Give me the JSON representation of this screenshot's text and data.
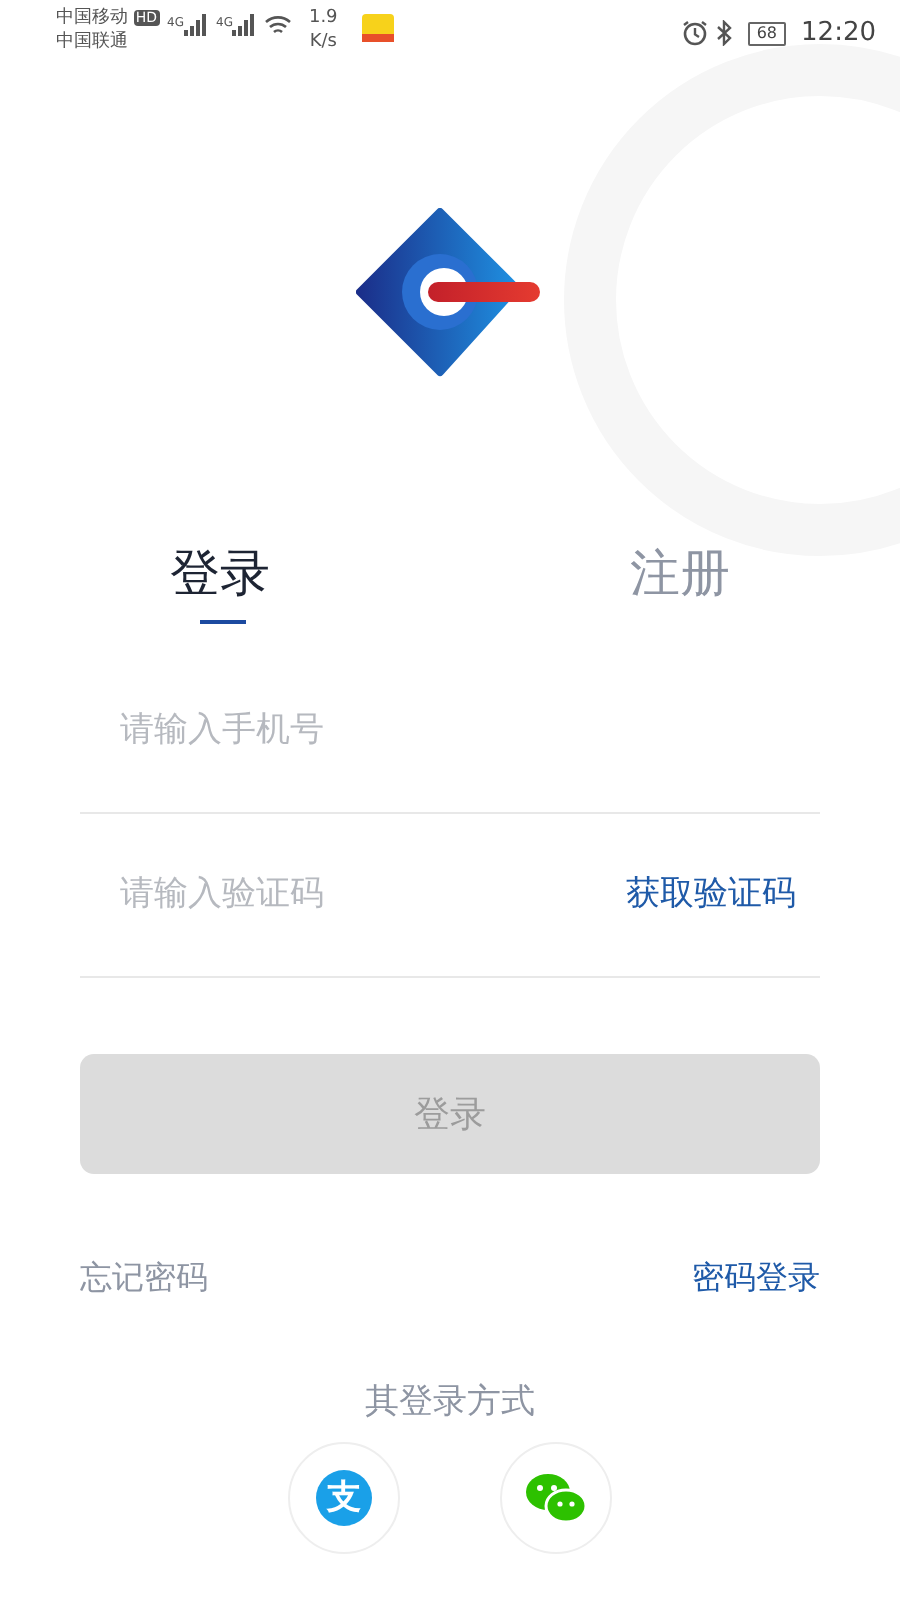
{
  "status_bar": {
    "carrier_1": "中国移动",
    "hd": "HD",
    "carrier_2": "中国联通",
    "signal_labels": [
      "4G",
      "4G"
    ],
    "speed_value": "1.9",
    "speed_unit": "K/s",
    "battery": "68",
    "time": "12:20"
  },
  "tabs": [
    {
      "label": "登录",
      "selected": true
    },
    {
      "label": "注册",
      "selected": false
    }
  ],
  "fields": [
    {
      "placeholder": "请输入手机号"
    },
    {
      "placeholder": "请输入验证码",
      "action": "获取验证码"
    }
  ],
  "login_button": {
    "label": "登录",
    "disabled": true
  },
  "links": {
    "forgot": "忘记密码",
    "password_login": "密码登录"
  },
  "other_login": {
    "title": "其登录方式",
    "options": [
      {
        "kind": "alipay",
        "glyph": "支"
      },
      {
        "kind": "wechat"
      }
    ]
  }
}
